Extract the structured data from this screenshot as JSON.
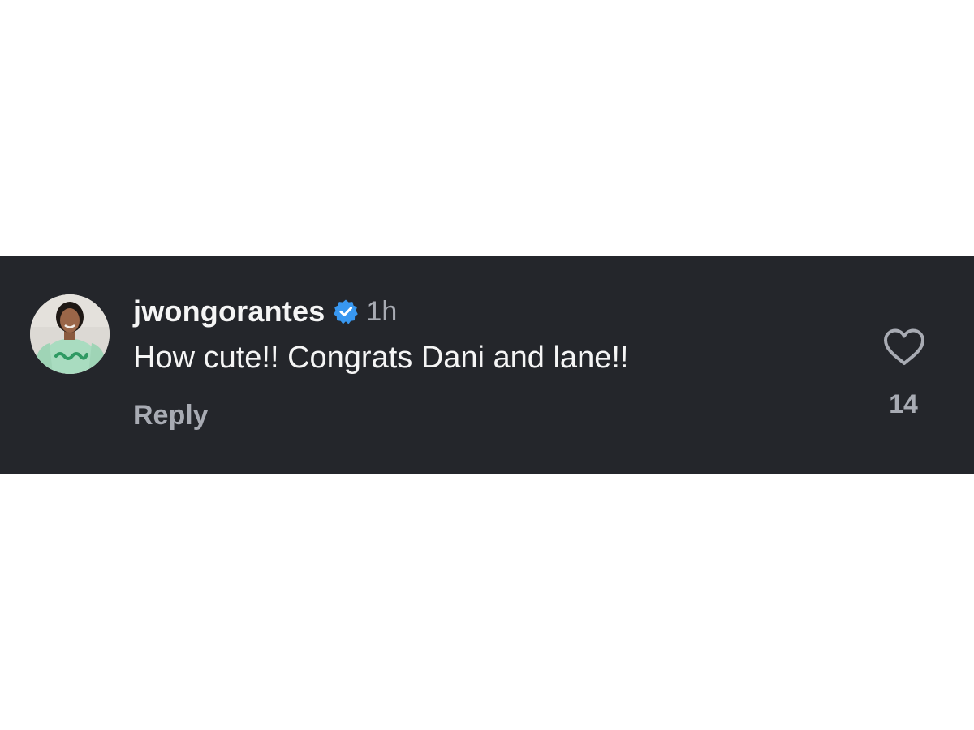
{
  "comment": {
    "username": "jwongorantes",
    "verified_icon": "verified-badge-icon",
    "timestamp": "1h",
    "text": "How cute!! Congrats Dani and lane!!",
    "reply_label": "Reply",
    "like_icon": "heart-outline-icon",
    "like_count": "14"
  },
  "colors": {
    "panel_background": "#24262b",
    "primary_text": "#f5f5f5",
    "secondary_text": "#a8abb3",
    "verified_blue": "#3897f0"
  }
}
